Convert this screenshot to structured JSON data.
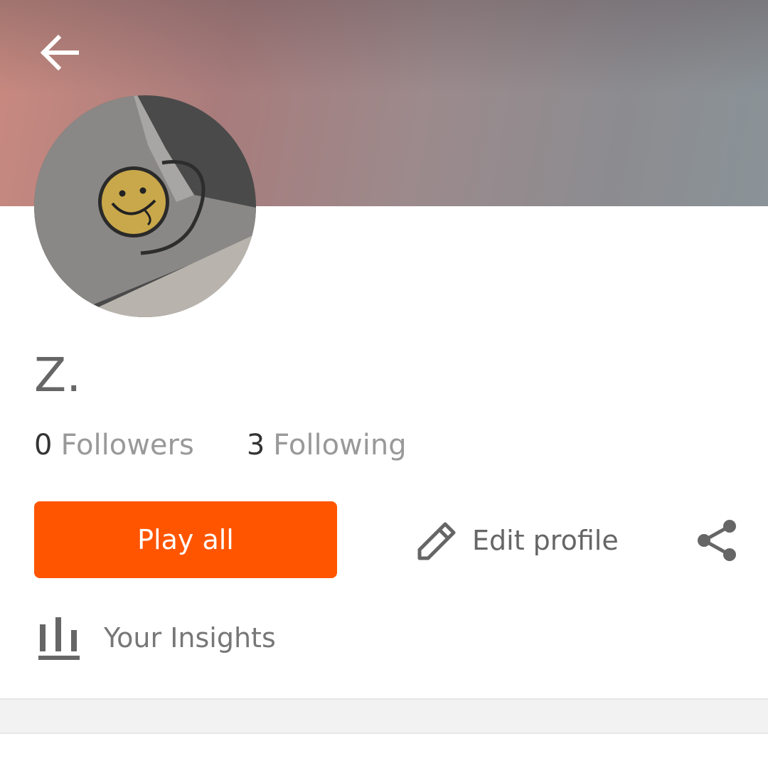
{
  "header": {
    "back_icon": "arrow-left-icon"
  },
  "profile": {
    "name": "Z.",
    "followers_count": "0",
    "followers_label": "Followers",
    "following_count": "3",
    "following_label": "Following"
  },
  "actions": {
    "play_all_label": "Play all",
    "edit_profile_label": "Edit profile",
    "edit_icon": "pencil-icon",
    "share_icon": "share-icon"
  },
  "insights": {
    "label": "Your Insights",
    "icon": "bar-chart-icon"
  },
  "colors": {
    "accent": "#ff5500",
    "text_primary": "#333333",
    "text_secondary": "#999999",
    "icon": "#666666"
  }
}
